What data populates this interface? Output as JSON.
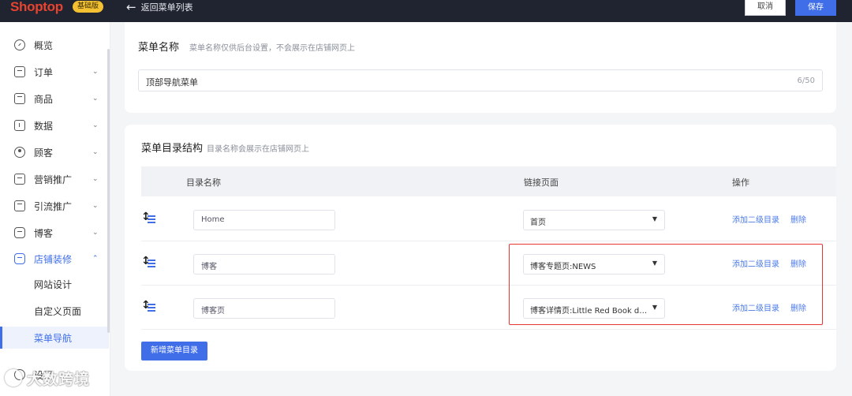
{
  "topbar": {
    "logo": "Shoptop",
    "plan_badge": "基础版",
    "back_label": "返回菜单列表",
    "cancel_label": "取消",
    "save_label": "保存"
  },
  "sidebar": {
    "items": [
      {
        "label": "概览",
        "icon": "dashboard-icon",
        "has_chevron": false
      },
      {
        "label": "订单",
        "icon": "order-icon",
        "has_chevron": true
      },
      {
        "label": "商品",
        "icon": "product-icon",
        "has_chevron": true
      },
      {
        "label": "数据",
        "icon": "chart-icon",
        "has_chevron": true
      },
      {
        "label": "顾客",
        "icon": "user-icon",
        "has_chevron": true
      },
      {
        "label": "营销推广",
        "icon": "ticket-icon",
        "has_chevron": true
      },
      {
        "label": "引流推广",
        "icon": "traffic-icon",
        "has_chevron": true
      },
      {
        "label": "博客",
        "icon": "blog-icon",
        "has_chevron": true
      },
      {
        "label": "店铺装修",
        "icon": "store-design-icon",
        "has_chevron": true,
        "expanded": true
      }
    ],
    "sub_items": [
      {
        "label": "网站设计"
      },
      {
        "label": "自定义页面"
      },
      {
        "label": "菜单导航",
        "selected": true
      }
    ],
    "settings_label": "设置",
    "watermark": "大数跨境"
  },
  "menu_name": {
    "title": "菜单名称",
    "hint": "菜单名称仅供后台设置，不会展示在店铺网页上",
    "value": "顶部导航菜单",
    "count": "6/50"
  },
  "structure": {
    "title": "菜单目录结构",
    "hint": "目录名称会展示在店铺网页上",
    "columns": {
      "name": "目录名称",
      "link": "链接页面",
      "actions": "操作"
    },
    "rows": [
      {
        "name": "Home",
        "link": "首页",
        "add_sub": "添加二级目录",
        "delete": "删除"
      },
      {
        "name": "博客",
        "link": "博客专题页:NEWS",
        "add_sub": "添加二级目录",
        "delete": "删除"
      },
      {
        "name": "博客页",
        "link": "博客详情页:Little Red Book drainage",
        "add_sub": "添加二级目录",
        "delete": "删除"
      }
    ],
    "add_button": "新增菜单目录"
  },
  "colors": {
    "accent": "#3f6ee8",
    "topbar": "#1f2430",
    "highlight": "#e5372f",
    "logo": "#e7432f"
  }
}
